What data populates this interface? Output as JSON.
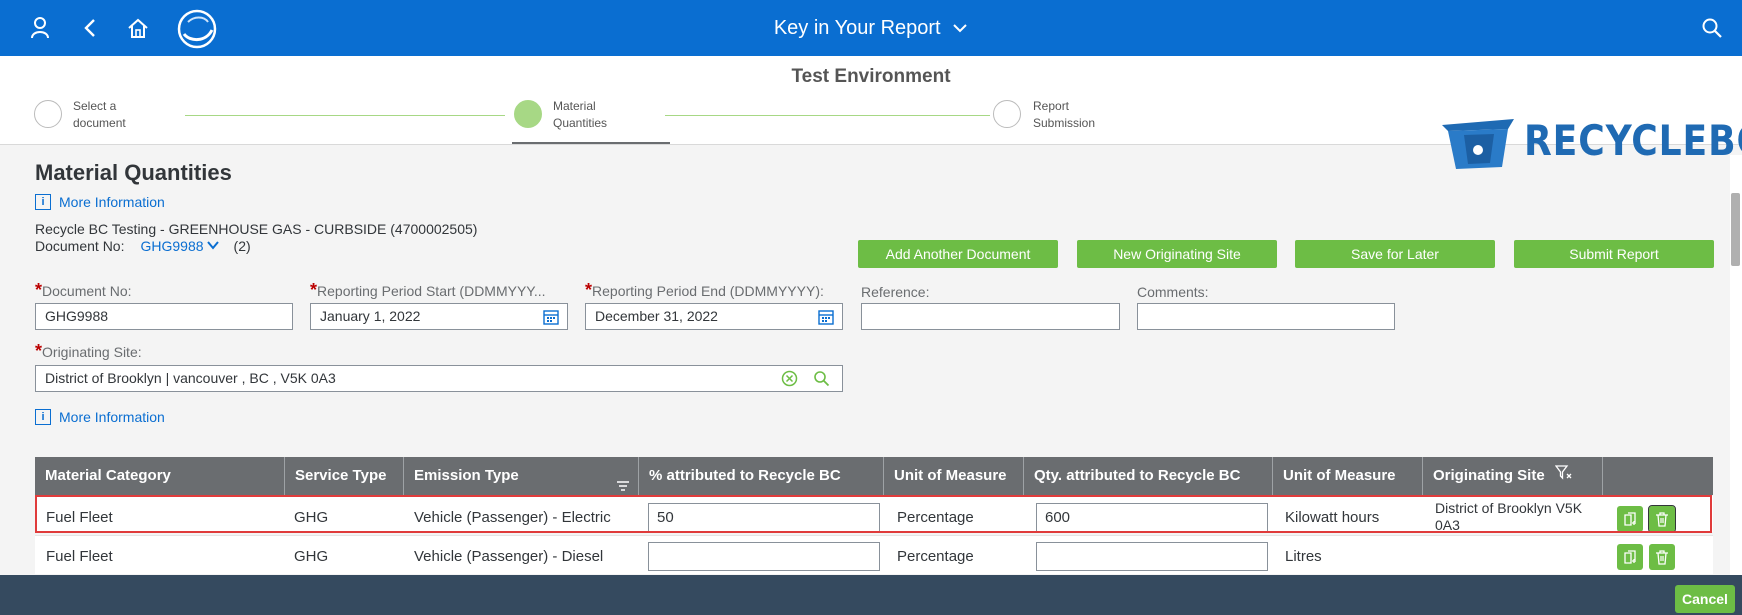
{
  "shellbar": {
    "title": "Key in Your Report",
    "icons": [
      "user-icon",
      "back-icon",
      "home-icon",
      "app-logo-icon",
      "title-chevron-down-icon",
      "search-icon"
    ]
  },
  "stepper": {
    "environment": "Test Environment",
    "steps": [
      {
        "label_line1": "Select a",
        "label_line2": "document",
        "state": "done"
      },
      {
        "label_line1": "Material",
        "label_line2": "Quantities",
        "state": "active"
      },
      {
        "label_line1": "Report",
        "label_line2": "Submission",
        "state": "todo"
      }
    ]
  },
  "brand": {
    "logo_text": "RECYCLEBC",
    "color": "#1f6ab3"
  },
  "page": {
    "title": "Material Quantities",
    "more_info": "More Information",
    "org_line": "Recycle BC Testing - GREENHOUSE GAS - CURBSIDE (4700002505)",
    "doc_no_label": "Document No:",
    "doc_no_value": "GHG9988",
    "doc_count": "(2)"
  },
  "actions": {
    "add_document": "Add Another Document",
    "new_site": "New Originating Site",
    "save_later": "Save for Later",
    "submit": "Submit Report"
  },
  "form": {
    "document_no": {
      "label": "Document No:",
      "value": "GHG9988"
    },
    "period_start": {
      "label": "Reporting Period Start (DDMMYYY...",
      "value": "January 1, 2022"
    },
    "period_end": {
      "label": "Reporting Period End (DDMMYYYY):",
      "value": "December 31, 2022"
    },
    "reference": {
      "label": "Reference:",
      "value": ""
    },
    "comments": {
      "label": "Comments:",
      "value": ""
    },
    "originating_site": {
      "label": "Originating Site:",
      "value": "District of Brooklyn | vancouver , BC , V5K 0A3"
    },
    "more_info": "More Information"
  },
  "table": {
    "headers": [
      "Material Category",
      "Service Type",
      "Emission Type",
      "% attributed to Recycle BC",
      "Unit of Measure",
      "Qty. attributed to Recycle BC",
      "Unit of Measure",
      "Originating Site"
    ],
    "rows": [
      {
        "category": "Fuel Fleet",
        "service": "GHG",
        "emission": "Vehicle (Passenger) - Electric",
        "percent": "50",
        "unit1": "Percentage",
        "qty": "600",
        "unit2": "Kilowatt hours",
        "site_line1": "District of Brooklyn V5K",
        "site_line2": "0A3",
        "highlighted": true
      },
      {
        "category": "Fuel Fleet",
        "service": "GHG",
        "emission": "Vehicle (Passenger) - Diesel",
        "percent": "",
        "unit1": "Percentage",
        "qty": "",
        "unit2": "Litres",
        "site_line1": "",
        "site_line2": "",
        "highlighted": false
      }
    ]
  },
  "footer": {
    "cancel": "Cancel"
  },
  "colors": {
    "shell": "#0a6ed1",
    "accent_green": "#6dbd45",
    "table_header": "#6a6d70",
    "highlight": "#e03b3b",
    "footer": "#354a5f"
  }
}
